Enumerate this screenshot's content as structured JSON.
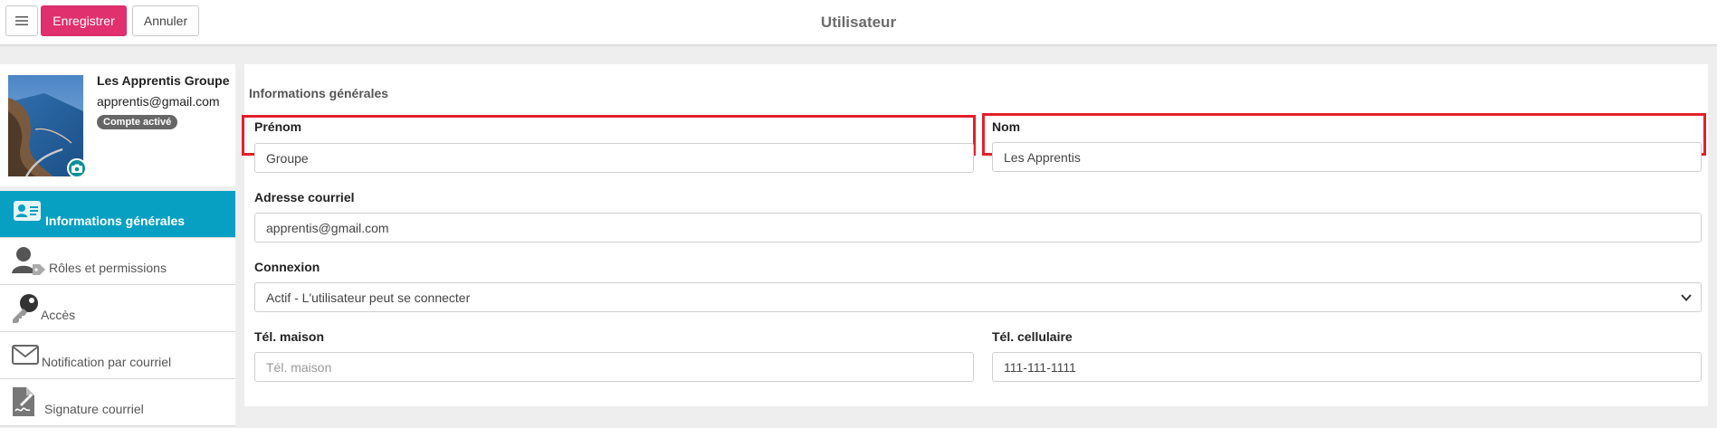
{
  "toolbar": {
    "menu_icon": "hamburger-icon",
    "save_label": "Enregistrer",
    "cancel_label": "Annuler",
    "title": "Utilisateur",
    "save_color": "#e0306e"
  },
  "profile": {
    "name": "Les Apprentis Groupe",
    "email": "apprentis@gmail.com",
    "status_badge": "Compte activé",
    "avatar_icon": "camera-icon"
  },
  "sidebar": {
    "accent_color": "#07a0c2",
    "items": [
      {
        "label": "Informations générales",
        "icon": "id-card-icon",
        "active": true
      },
      {
        "label": "Rôles et permissions",
        "icon": "user-tag-icon",
        "active": false
      },
      {
        "label": "Accès",
        "icon": "key-icon",
        "active": false
      },
      {
        "label": "Notification par courriel",
        "icon": "envelope-icon",
        "active": false
      },
      {
        "label": "Signature courriel",
        "icon": "signature-icon",
        "active": false
      }
    ]
  },
  "form": {
    "section_title": "Informations générales",
    "prenom": {
      "label": "Prénom",
      "value": "Groupe"
    },
    "nom": {
      "label": "Nom",
      "value": "Les Apprentis"
    },
    "email": {
      "label": "Adresse courriel",
      "value": "apprentis@gmail.com"
    },
    "connexion": {
      "label": "Connexion",
      "value": "Actif - L'utilisateur peut se connecter"
    },
    "tel_maison": {
      "label": "Tél. maison",
      "value": "",
      "placeholder": "Tél. maison"
    },
    "tel_cell": {
      "label": "Tél. cellulaire",
      "value": "111-111-1111"
    },
    "highlight_color": "#e3202b"
  }
}
